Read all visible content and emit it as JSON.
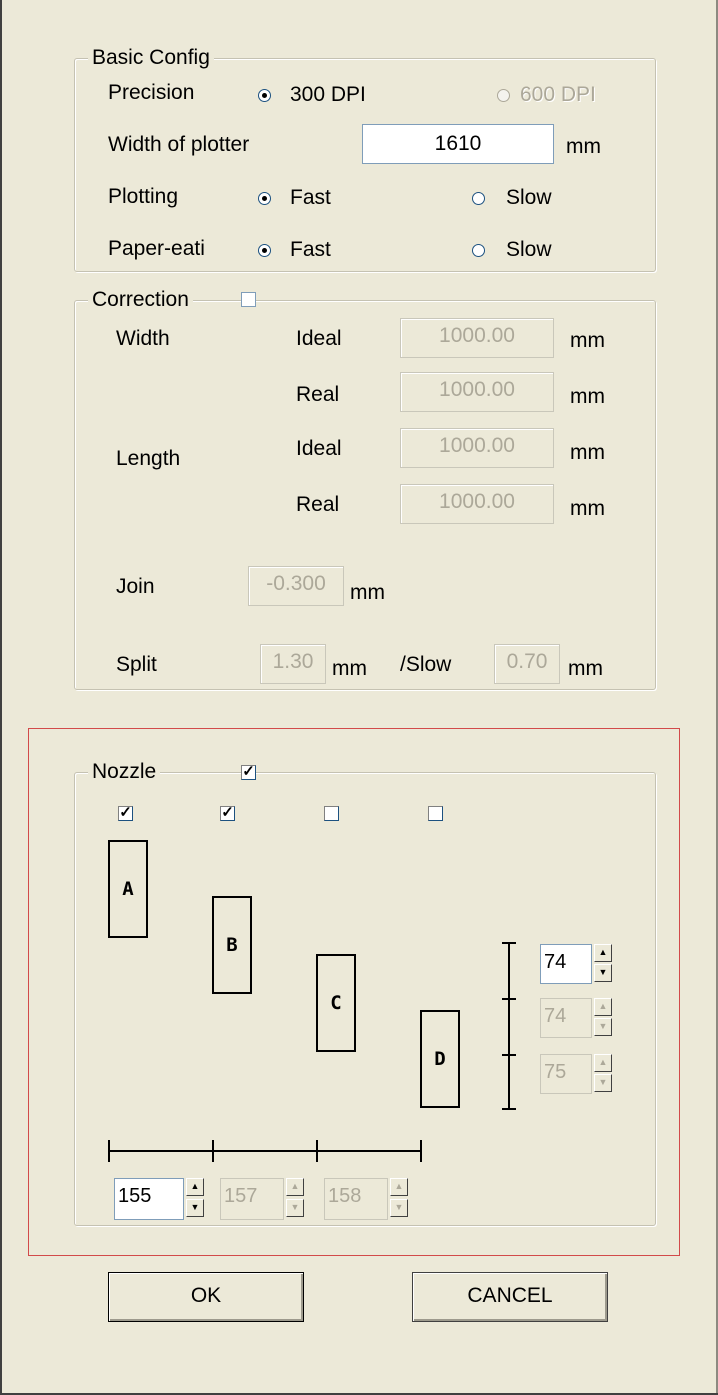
{
  "basic": {
    "legend": "Basic Config",
    "precision_label": "Precision",
    "dpi300": "300 DPI",
    "dpi600": "600 DPI",
    "width_label": "Width of plotter",
    "width_value": "1610",
    "width_unit": "mm",
    "plotting_label": "Plotting",
    "plotting_fast": "Fast",
    "plotting_slow": "Slow",
    "paper_label": "Paper-eati",
    "paper_fast": "Fast",
    "paper_slow": "Slow"
  },
  "correction": {
    "legend": "Correction",
    "width_label": "Width",
    "length_label": "Length",
    "ideal": "Ideal",
    "real": "Real",
    "width_ideal": "1000.00",
    "width_real": "1000.00",
    "length_ideal": "1000.00",
    "length_real": "1000.00",
    "mm": "mm",
    "join_label": "Join",
    "join_value": "-0.300",
    "split_label": "Split",
    "split_value": "1.30",
    "slow_label": "/Slow",
    "slow_value": "0.70"
  },
  "nozzle": {
    "legend": "Nozzle",
    "enable_checked": true,
    "checks": [
      true,
      true,
      false,
      false
    ],
    "letters": [
      "A",
      "B",
      "C",
      "D"
    ],
    "v_spins": [
      "74",
      "74",
      "75"
    ],
    "h_spins": [
      "155",
      "157",
      "158"
    ]
  },
  "buttons": {
    "ok": "OK",
    "cancel": "CANCEL"
  },
  "icons": {
    "up": "▲",
    "down": "▼",
    "check": "✓"
  }
}
